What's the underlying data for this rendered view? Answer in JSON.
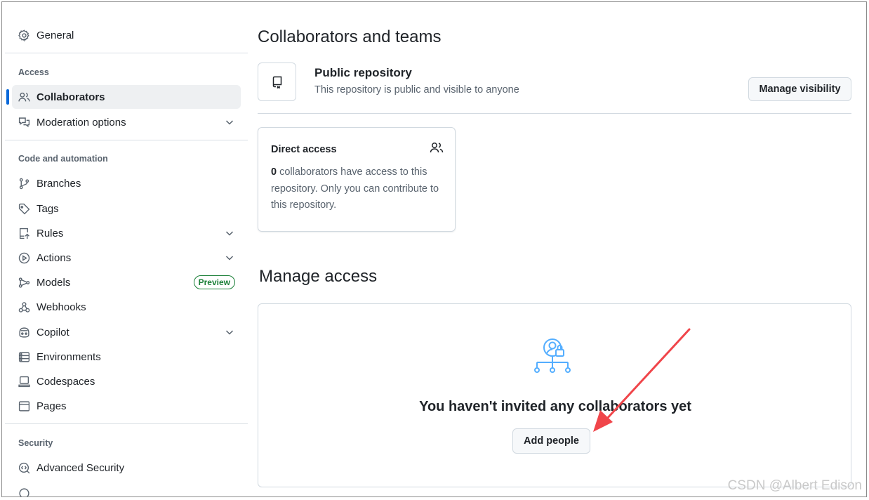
{
  "sidebar": {
    "general": "General",
    "sections": {
      "access": "Access",
      "code_automation": "Code and automation",
      "security": "Security"
    },
    "items": {
      "collaborators": "Collaborators",
      "moderation": "Moderation options",
      "branches": "Branches",
      "tags": "Tags",
      "rules": "Rules",
      "actions": "Actions",
      "models": "Models",
      "models_badge": "Preview",
      "webhooks": "Webhooks",
      "copilot": "Copilot",
      "environments": "Environments",
      "codespaces": "Codespaces",
      "pages": "Pages",
      "advanced_security": "Advanced Security"
    }
  },
  "main": {
    "title": "Collaborators and teams",
    "repo": {
      "title": "Public repository",
      "subtitle": "This repository is public and visible to anyone",
      "manage_button": "Manage visibility"
    },
    "direct_access": {
      "title": "Direct access",
      "count": "0",
      "text": " collaborators have access to this repository. Only you can contribute to this repository."
    },
    "manage_access": {
      "title": "Manage access",
      "empty_text": "You haven't invited any collaborators yet",
      "add_button": "Add people"
    }
  },
  "colors": {
    "accent": "#0969da",
    "annotation_arrow": "#f0454a",
    "preview_badge": "#1a7f37"
  },
  "watermark": "CSDN @Albert Edison"
}
